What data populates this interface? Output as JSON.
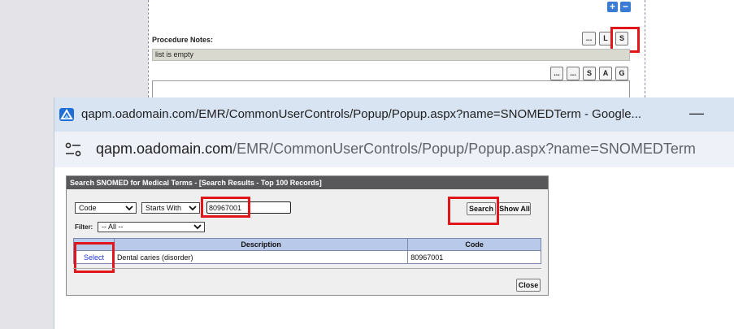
{
  "background_page": {
    "plus_label": "+",
    "minus_label": "−",
    "procedure_notes_label": "Procedure Notes:",
    "toolbar_row1": [
      "...",
      "L",
      "S"
    ],
    "list_empty_text": "list is empty",
    "toolbar_row2": [
      "...",
      "...",
      "S",
      "A",
      "G"
    ]
  },
  "window": {
    "title": "qapm.oadomain.com/EMR/CommonUserControls/Popup/Popup.aspx?name=SNOMEDTerm - Google...",
    "minimize_label": "—",
    "url_host": "qapm.oadomain.com",
    "url_path": "/EMR/CommonUserControls/Popup/Popup.aspx?name=SNOMEDTerm"
  },
  "snomed_panel": {
    "header": "Search SNOMED for Medical Terms - [Search Results - Top 100 Records]",
    "field_select": "Code",
    "match_select": "Starts With",
    "search_value": "80967001",
    "search_label": "Search",
    "show_all_label": "Show All",
    "filter_label": "Filter:",
    "filter_value": "-- All --",
    "columns": [
      "",
      "Description",
      "Code"
    ],
    "rows": [
      {
        "action": "Select",
        "description": "Dental caries (disorder)",
        "code": "80967001"
      }
    ],
    "close_label": "Close"
  },
  "colors": {
    "highlight": "#e0161b",
    "header_bg": "#58585a",
    "table_header_bg": "#b9c9ea",
    "link": "#2233cc"
  }
}
